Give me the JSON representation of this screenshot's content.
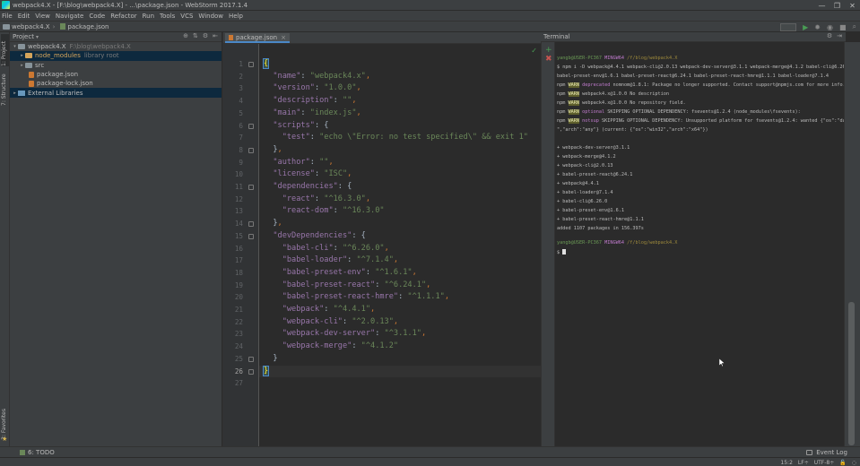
{
  "window": {
    "title": "webpack4.X - [F:\\blog\\webpack4.X] - ...\\package.json - WebStorm 2017.1.4",
    "controls": [
      "—",
      "❐",
      "✕"
    ]
  },
  "menu": [
    "File",
    "Edit",
    "View",
    "Navigate",
    "Code",
    "Refactor",
    "Run",
    "Tools",
    "VCS",
    "Window",
    "Help"
  ],
  "nav": {
    "crumbs": [
      "webpack4.X",
      "package.json"
    ]
  },
  "left_tabs": [
    "1: Project",
    "7: Structure"
  ],
  "project_panel": {
    "label": "Project",
    "tree": [
      {
        "label": "webpack4.X",
        "hint": "F:\\blog\\webpack4.X",
        "type": "root",
        "arrow": "▾"
      },
      {
        "label": "node_modules",
        "hint": "library root",
        "type": "excluded",
        "arrow": "▸"
      },
      {
        "label": "src",
        "hint": "",
        "type": "folder",
        "arrow": "▸"
      },
      {
        "label": "package.json",
        "hint": "",
        "type": "file",
        "arrow": ""
      },
      {
        "label": "package-lock.json",
        "hint": "",
        "type": "file",
        "arrow": ""
      },
      {
        "label": "External Libraries",
        "hint": "",
        "type": "lib",
        "arrow": "▸"
      }
    ]
  },
  "editor": {
    "tab_label": "package.json",
    "current_line": 26,
    "lines": [
      {
        "n": "1",
        "html": "<span class=\"brace-hl\">{</span>"
      },
      {
        "n": "2",
        "html": "  <span class=\"k\">\"name\"</span>: <span class=\"s\">\"webpack4.x\"</span><span class=\"p\">,</span>"
      },
      {
        "n": "3",
        "html": "  <span class=\"k\">\"version\"</span>: <span class=\"s\">\"1.0.0\"</span><span class=\"p\">,</span>"
      },
      {
        "n": "4",
        "html": "  <span class=\"k\">\"description\"</span>: <span class=\"s\">\"\"</span><span class=\"p\">,</span>"
      },
      {
        "n": "5",
        "html": "  <span class=\"k\">\"main\"</span>: <span class=\"s\">\"index.js\"</span><span class=\"p\">,</span>"
      },
      {
        "n": "6",
        "html": "  <span class=\"k\">\"scripts\"</span>: {"
      },
      {
        "n": "7",
        "html": "    <span class=\"k\">\"test\"</span>: <span class=\"s\">\"echo \\\"Error: no test specified\\\" &amp;&amp; exit 1\"</span>"
      },
      {
        "n": "8",
        "html": "  }<span class=\"p\">,</span>"
      },
      {
        "n": "9",
        "html": "  <span class=\"k\">\"author\"</span>: <span class=\"s\">\"\"</span><span class=\"p\">,</span>"
      },
      {
        "n": "10",
        "html": "  <span class=\"k\">\"license\"</span>: <span class=\"s\">\"ISC\"</span><span class=\"p\">,</span>"
      },
      {
        "n": "11",
        "html": "  <span class=\"k\">\"dependencies\"</span>: {"
      },
      {
        "n": "12",
        "html": "    <span class=\"k\">\"react\"</span>: <span class=\"s\">\"^16.3.0\"</span><span class=\"p\">,</span>"
      },
      {
        "n": "13",
        "html": "    <span class=\"k\">\"react-dom\"</span>: <span class=\"s\">\"^16.3.0\"</span>"
      },
      {
        "n": "14",
        "html": "  }<span class=\"p\">,</span>"
      },
      {
        "n": "15",
        "html": "  <span class=\"k\">\"devDependencies\"</span>: {"
      },
      {
        "n": "16",
        "html": "    <span class=\"k\">\"babel-cli\"</span>: <span class=\"s\">\"^6.26.0\"</span><span class=\"p\">,</span>"
      },
      {
        "n": "17",
        "html": "    <span class=\"k\">\"babel-loader\"</span>: <span class=\"s\">\"^7.1.4\"</span><span class=\"p\">,</span>"
      },
      {
        "n": "18",
        "html": "    <span class=\"k\">\"babel-preset-env\"</span>: <span class=\"s\">\"^1.6.1\"</span><span class=\"p\">,</span>"
      },
      {
        "n": "19",
        "html": "    <span class=\"k\">\"babel-preset-react\"</span>: <span class=\"s\">\"^6.24.1\"</span><span class=\"p\">,</span>"
      },
      {
        "n": "20",
        "html": "    <span class=\"k\">\"babel-preset-react-hmre\"</span>: <span class=\"s\">\"^1.1.1\"</span><span class=\"p\">,</span>"
      },
      {
        "n": "21",
        "html": "    <span class=\"k\">\"webpack\"</span>: <span class=\"s\">\"^4.4.1\"</span><span class=\"p\">,</span>"
      },
      {
        "n": "22",
        "html": "    <span class=\"k\">\"webpack-cli\"</span>: <span class=\"s\">\"^2.0.13\"</span><span class=\"p\">,</span>"
      },
      {
        "n": "23",
        "html": "    <span class=\"k\">\"webpack-dev-server\"</span>: <span class=\"s\">\"^3.1.1\"</span><span class=\"p\">,</span>"
      },
      {
        "n": "24",
        "html": "    <span class=\"k\">\"webpack-merge\"</span>: <span class=\"s\">\"^4.1.2\"</span>"
      },
      {
        "n": "25",
        "html": "  }"
      },
      {
        "n": "26",
        "html": "<span class=\"brace-hl\">}</span>"
      },
      {
        "n": "27",
        "html": ""
      }
    ]
  },
  "terminal": {
    "label": "Terminal",
    "lines": [
      {
        "t": 6,
        "html": "<span class=\"green\">yangb@USER-PC367</span> <span class=\"mag\">MINGW64</span> <span class=\"yel\">/f/blog/webpack4.X</span>"
      },
      {
        "t": 16,
        "html": "$ npm i -D webpack@4.4.1 webpack-cli@2.0.13 webpack-dev-server@3.1.1 webpack-merge@4.1.2 babel-cli@6.26.0"
      },
      {
        "t": 26,
        "html": "babel-preset-env@1.6.1 babel-preset-react@6.24.1 babel-preset-react-hmre@1.1.1 babel-loader@7.1.4"
      },
      {
        "t": 36,
        "html": "npm <span class=\"warnbg\">WARN</span> <span class=\"mag\">deprecated</span> nomnom@1.8.1: Package no longer supported. Contact support@npmjs.com for more info."
      },
      {
        "t": 46,
        "html": "npm <span class=\"warnbg\">WARN</span> webpack4.x@1.0.0 No description"
      },
      {
        "t": 56,
        "html": "npm <span class=\"warnbg\">WARN</span> webpack4.x@1.0.0 No repository field."
      },
      {
        "t": 66,
        "html": "npm <span class=\"warnbg\">WARN</span> <span class=\"mag\">optional</span> SKIPPING OPTIONAL DEPENDENCY: fsevents@1.2.4 (node_modules\\fsevents):"
      },
      {
        "t": 76,
        "html": "npm <span class=\"warnbg\">WARN</span> <span class=\"mag\">notsup</span> SKIPPING OPTIONAL DEPENDENCY: Unsupported platform for fsevents@1.2.4: wanted {\"os\":\"darwin"
      },
      {
        "t": 86,
        "html": "\",\"arch\":\"any\"} (current: {\"os\":\"win32\",\"arch\":\"x64\"})"
      },
      {
        "t": 106,
        "html": "+ webpack-dev-server@3.1.1"
      },
      {
        "t": 116,
        "html": "+ webpack-merge@4.1.2"
      },
      {
        "t": 126,
        "html": "+ webpack-cli@2.0.13"
      },
      {
        "t": 136,
        "html": "+ babel-preset-react@6.24.1"
      },
      {
        "t": 146,
        "html": "+ webpack@4.4.1"
      },
      {
        "t": 156,
        "html": "+ babel-loader@7.1.4"
      },
      {
        "t": 166,
        "html": "+ babel-cli@6.26.0"
      },
      {
        "t": 176,
        "html": "+ babel-preset-env@1.6.1"
      },
      {
        "t": 186,
        "html": "+ babel-preset-react-hmre@1.1.1"
      },
      {
        "t": 196,
        "html": "added 1107 packages in 156.397s"
      },
      {
        "t": 212,
        "html": "<span class=\"green\">yangb@USER-PC367</span> <span class=\"mag\">MINGW64</span> <span class=\"yel\">/f/blog/webpack4.X</span>"
      },
      {
        "t": 222,
        "html": "$ <span class=\"cursor\"></span>"
      }
    ]
  },
  "bottom": {
    "todo": "6: TODO",
    "event_log": "Event Log"
  },
  "favorites_tab": "2: Favorites",
  "status": {
    "position": "15:2",
    "line_sep": "LF÷",
    "encoding": "UTF-8÷"
  }
}
